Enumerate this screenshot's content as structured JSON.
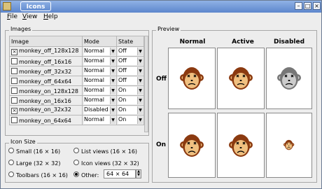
{
  "window": {
    "title": "Icons"
  },
  "menu": [
    {
      "label": "File",
      "mnemonic": "F",
      "rest": "ile"
    },
    {
      "label": "View",
      "mnemonic": "V",
      "rest": "iew"
    },
    {
      "label": "Help",
      "mnemonic": "H",
      "rest": "elp"
    }
  ],
  "images_group": {
    "label": "Images",
    "headers": {
      "image": "Image",
      "mode": "Mode",
      "state": "State"
    },
    "rows": [
      {
        "name": "monkey_off_128x128",
        "checked": true,
        "mode": "Normal",
        "state": "Off"
      },
      {
        "name": "monkey_off_16x16",
        "checked": false,
        "mode": "Normal",
        "state": "Off"
      },
      {
        "name": "monkey_off_32x32",
        "checked": false,
        "mode": "Normal",
        "state": "Off"
      },
      {
        "name": "monkey_off_64x64",
        "checked": false,
        "mode": "Normal",
        "state": "Off"
      },
      {
        "name": "monkey_on_128x128",
        "checked": false,
        "mode": "Normal",
        "state": "On"
      },
      {
        "name": "monkey_on_16x16",
        "checked": false,
        "mode": "Normal",
        "state": "On"
      },
      {
        "name": "monkey_on_32x32",
        "checked": true,
        "mode": "Disabled",
        "state": "On"
      },
      {
        "name": "monkey_on_64x64",
        "checked": false,
        "mode": "Normal",
        "state": "On"
      }
    ]
  },
  "icon_size_group": {
    "label": "Icon Size",
    "options": [
      {
        "label": "Small (16 × 16)",
        "selected": false
      },
      {
        "label": "List views (16 × 16)",
        "selected": false
      },
      {
        "label": "Large (32 × 32)",
        "selected": false
      },
      {
        "label": "Icon views (32 × 32)",
        "selected": false
      },
      {
        "label": "Toolbars (16 × 16)",
        "selected": false
      },
      {
        "label": "Other:",
        "selected": true
      }
    ],
    "other_value": "64 × 64"
  },
  "preview_group": {
    "label": "Preview",
    "columns": [
      "Normal",
      "Active",
      "Disabled"
    ],
    "rows": [
      "Off",
      "On"
    ]
  },
  "colors": {
    "monkey_fur": "#8b3a10",
    "monkey_face": "#f0c080",
    "titlebar": "#6e95d8"
  }
}
